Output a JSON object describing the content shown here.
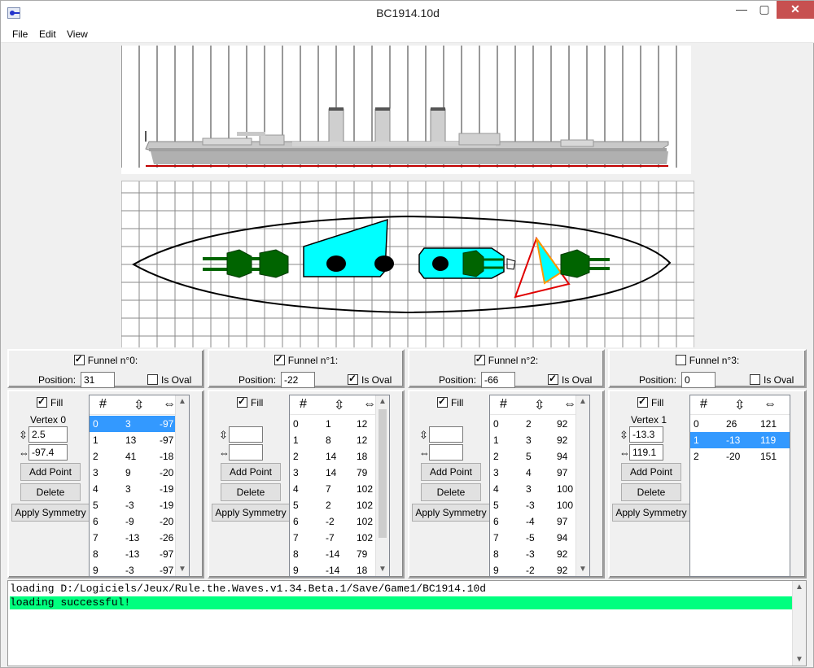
{
  "window": {
    "title": "BC1914.10d",
    "minimize": "—",
    "maximize": "▢",
    "close": "✕"
  },
  "menu": [
    "File",
    "Edit",
    "View"
  ],
  "funnels": [
    {
      "label": "Funnel n°0:",
      "checked": true,
      "position_label": "Position:",
      "position": "31",
      "oval_label": "Is Oval",
      "is_oval": false
    },
    {
      "label": "Funnel n°1:",
      "checked": true,
      "position_label": "Position:",
      "position": "-22",
      "oval_label": "Is Oval",
      "is_oval": true
    },
    {
      "label": "Funnel n°2:",
      "checked": true,
      "position_label": "Position:",
      "position": "-66",
      "oval_label": "Is Oval",
      "is_oval": true
    },
    {
      "label": "Funnel n°3:",
      "checked": false,
      "position_label": "Position:",
      "position": "0",
      "oval_label": "Is Oval",
      "is_oval": false
    }
  ],
  "vertex_panels": [
    {
      "fill_label": "Fill",
      "fill": true,
      "vertex_label": "Vertex 0",
      "v_value": "2.5",
      "h_value": "-97.4",
      "add_label": "Add Point",
      "delete_label": "Delete",
      "symmetry_label": "Apply Symmetry",
      "headers": [
        "#",
        "⇳",
        "⇔"
      ],
      "rows": [
        [
          "0",
          "3",
          "-97"
        ],
        [
          "1",
          "13",
          "-97"
        ],
        [
          "2",
          "41",
          "-18"
        ],
        [
          "3",
          "9",
          "-20"
        ],
        [
          "4",
          "3",
          "-19"
        ],
        [
          "5",
          "-3",
          "-19"
        ],
        [
          "6",
          "-9",
          "-20"
        ],
        [
          "7",
          "-13",
          "-26"
        ],
        [
          "8",
          "-13",
          "-97"
        ],
        [
          "9",
          "-3",
          "-97"
        ]
      ],
      "selected": 0
    },
    {
      "fill_label": "Fill",
      "fill": true,
      "vertex_label": "",
      "v_value": "",
      "h_value": "",
      "add_label": "Add Point",
      "delete_label": "Delete",
      "symmetry_label": "Apply Symmetry",
      "headers": [
        "#",
        "⇳",
        "⇔"
      ],
      "rows": [
        [
          "0",
          "1",
          "12"
        ],
        [
          "1",
          "8",
          "12"
        ],
        [
          "2",
          "14",
          "18"
        ],
        [
          "3",
          "14",
          "79"
        ],
        [
          "4",
          "7",
          "102"
        ],
        [
          "5",
          "2",
          "102"
        ],
        [
          "6",
          "-2",
          "102"
        ],
        [
          "7",
          "-7",
          "102"
        ],
        [
          "8",
          "-14",
          "79"
        ],
        [
          "9",
          "-14",
          "18"
        ]
      ],
      "selected": -1
    },
    {
      "fill_label": "Fill",
      "fill": true,
      "vertex_label": "",
      "v_value": "",
      "h_value": "",
      "add_label": "Add Point",
      "delete_label": "Delete",
      "symmetry_label": "Apply Symmetry",
      "headers": [
        "#",
        "⇳",
        "⇔"
      ],
      "rows": [
        [
          "0",
          "2",
          "92"
        ],
        [
          "1",
          "3",
          "92"
        ],
        [
          "2",
          "5",
          "94"
        ],
        [
          "3",
          "4",
          "97"
        ],
        [
          "4",
          "3",
          "100"
        ],
        [
          "5",
          "-3",
          "100"
        ],
        [
          "6",
          "-4",
          "97"
        ],
        [
          "7",
          "-5",
          "94"
        ],
        [
          "8",
          "-3",
          "92"
        ],
        [
          "9",
          "-2",
          "92"
        ]
      ],
      "selected": -1
    },
    {
      "fill_label": "Fill",
      "fill": true,
      "vertex_label": "Vertex 1",
      "v_value": "-13.3",
      "h_value": "119.1",
      "add_label": "Add Point",
      "delete_label": "Delete",
      "symmetry_label": "Apply Symmetry",
      "headers": [
        "#",
        "⇳",
        "⇔"
      ],
      "rows": [
        [
          "0",
          "26",
          "121"
        ],
        [
          "1",
          "-13",
          "119"
        ],
        [
          "2",
          "-20",
          "151"
        ]
      ],
      "selected": 1
    }
  ],
  "console": [
    {
      "text": "loading D:/Logiciels/Jeux/Rule.the.Waves.v1.34.Beta.1/Save/Game1/BC1914.10d",
      "status": "normal"
    },
    {
      "text": "loading successful!",
      "status": "success"
    }
  ],
  "colors": {
    "funnel_fill": "#00ffff",
    "gun_fill": "#006400",
    "success": "#00ff7f",
    "selection": "#3399ff",
    "waterline": "#c00000"
  }
}
